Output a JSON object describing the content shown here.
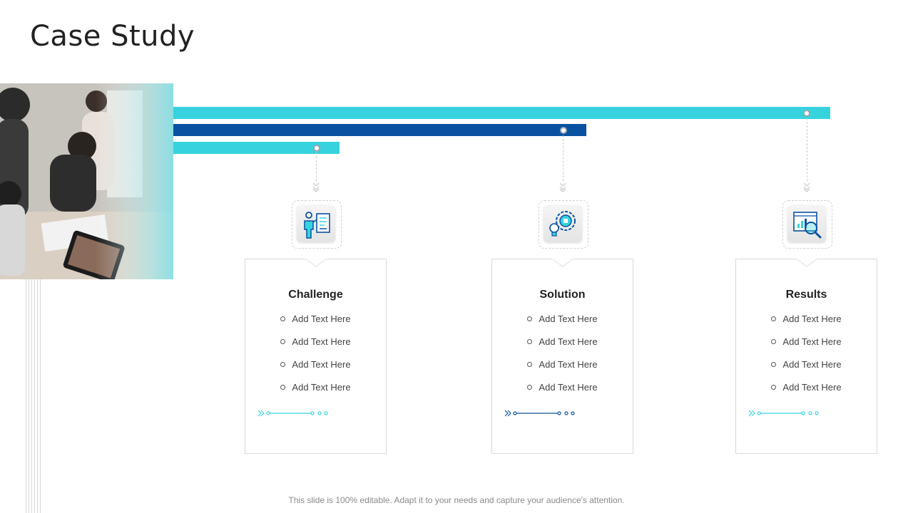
{
  "slide": {
    "title": "Case Study",
    "footer": "This slide is 100% editable. Adapt it to your needs and capture your audience's attention."
  },
  "colors": {
    "accent_light": "#36D3DF",
    "accent_dark": "#0A52A1",
    "border": "#D9D9D9",
    "text": "#222222"
  },
  "photo": {
    "description_icon": "team-photo"
  },
  "bars": [
    {
      "color": "#36D3DF",
      "fraction": 1.0
    },
    {
      "color": "#0A52A1",
      "fraction": 0.63
    },
    {
      "color": "#36D3DF",
      "fraction": 0.25
    }
  ],
  "cards": [
    {
      "title": "Challenge",
      "icon": "presenter-chart-icon",
      "items": [
        "Add Text Here",
        "Add Text Here",
        "Add Text Here",
        "Add Text Here"
      ],
      "deco_color": "#36D3DF"
    },
    {
      "title": "Solution",
      "icon": "gear-bulb-puzzle-icon",
      "items": [
        "Add Text Here",
        "Add Text Here",
        "Add Text Here",
        "Add Text Here"
      ],
      "deco_color": "#0A52A1"
    },
    {
      "title": "Results",
      "icon": "analytics-magnifier-icon",
      "items": [
        "Add Text Here",
        "Add Text Here",
        "Add Text Here",
        "Add Text Here"
      ],
      "deco_color": "#36D3DF"
    }
  ]
}
